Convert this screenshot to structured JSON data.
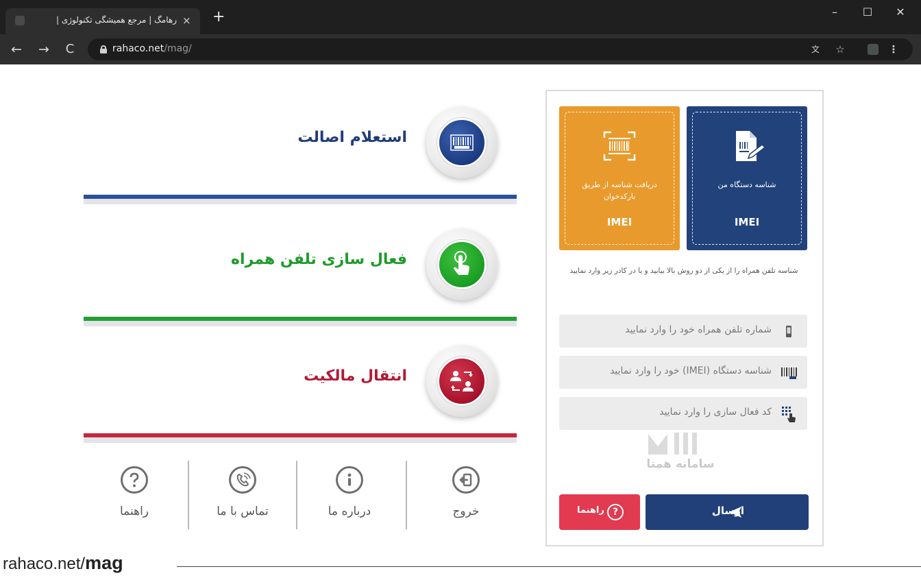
{
  "browser": {
    "tab_title": "رهامگ | مرجع همیشگی تکنولوژی |",
    "tab_close": "×",
    "new_tab": "+",
    "window_min": "–",
    "window_max": "☐",
    "window_close": "✕",
    "nav_back": "←",
    "nav_forward": "→",
    "nav_reload": "C",
    "url_host": "rahaco.net",
    "url_path": "/mag/",
    "star": "☆",
    "translate": "文",
    "menu": "⋮"
  },
  "menu": {
    "items": [
      {
        "label": "استعلام اصالت",
        "color": "#1f3d7a",
        "icon": "barcode-imei-icon"
      },
      {
        "label": "فعال سازی تلفن همراه",
        "color": "#1f9b2a",
        "icon": "touch-hand-icon"
      },
      {
        "label": "انتقال مالکیت",
        "color": "#b11a36",
        "icon": "transfer-users-icon"
      }
    ]
  },
  "bottom_nav": {
    "exit": "خروج",
    "about": "درباره ما",
    "contact": "تماس با ما",
    "help": "راهنما"
  },
  "panel": {
    "card_barcode": {
      "title": "دریافت شناسه از طریق بارکدخوان",
      "imei": "IMEI",
      "color": "#e99a2c"
    },
    "card_device": {
      "title": "شناسه دستگاه من",
      "imei": "IMEI",
      "color": "#22427c"
    },
    "instruction": "شناسه تلفن همراه را از یکی از دو روش بالا بیابید و یا در کادر زیر وارد نمایید",
    "fields": {
      "phone_placeholder": "شماره تلفن همراه خود را وارد نمایید",
      "imei_placeholder": "شناسه دستگاه (IMEI) خود را وارد نمایید",
      "code_placeholder": "کد فعال سازی را وارد نمایید"
    },
    "watermark": "سامانه همتا",
    "send_label": "ارسال",
    "help_label": "راهنما",
    "help_icon": "?"
  },
  "footer": {
    "brand_host": "rahaco.net/",
    "brand_mag": "mag"
  }
}
